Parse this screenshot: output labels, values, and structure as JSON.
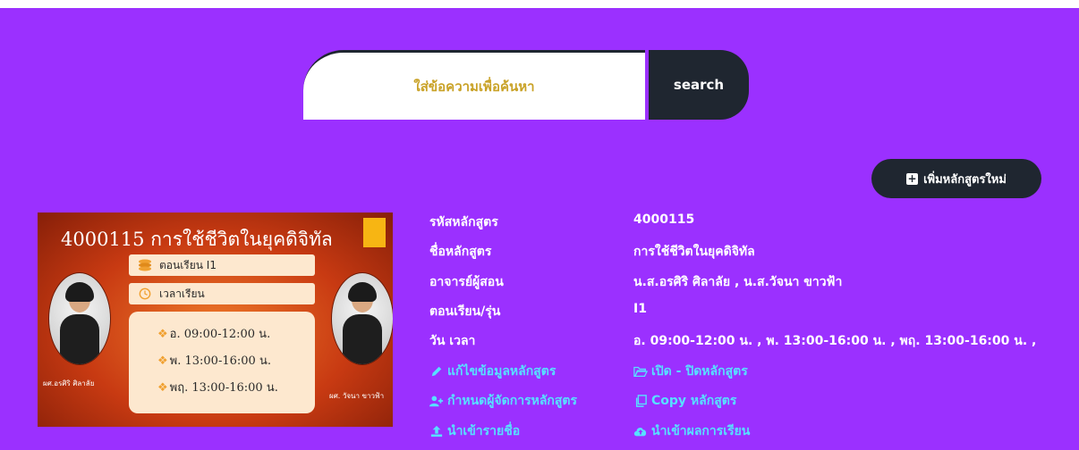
{
  "search": {
    "placeholder": "ใส่ข้อความเพื่อค้นหา",
    "button_label": "search"
  },
  "add_course_label": "เพิ่มหลักสูตรใหม่",
  "banner": {
    "title": "4000115  การใช้ชีวิตในยุคดิจิทัล",
    "section_label": "ตอนเรียน I1",
    "time_label": "เวลาเรียน",
    "schedule": [
      "อ.  09:00-12:00 น.",
      "พ.  13:00-16:00 น.",
      "พฤ. 13:00-16:00 น."
    ],
    "left_name": "ผศ.อรศิริ  ศิลาลัย",
    "right_name": "ผศ. วัจนา  ขาวฟ้า"
  },
  "course": {
    "code_label": "รหัสหลักสูตร",
    "code_value": "4000115",
    "name_label": "ชื่อหลักสูตร",
    "name_value": "การใช้ชีวิตในยุคดิจิทัล",
    "teacher_label": "อาจารย์ผู้สอน",
    "teacher_value": "น.ส.อรศิริ ศิลาลัย , น.ส.วัจนา ขาวฟ้า",
    "section_label": "ตอนเรียน/รุ่น",
    "section_value": "I1",
    "time_label": "วัน เวลา",
    "time_value": "อ. 09:00-12:00 น. , พ. 13:00-16:00 น. , พฤ. 13:00-16:00 น. ,"
  },
  "actions": {
    "edit": "แก้ไขข้อมูลหลักสูตร",
    "toggle": "เปิด - ปิดหลักสูตร",
    "assign_manager": "กำหนดผู้จัดการหลักสูตร",
    "copy": "Copy หลักสูตร",
    "import_names": "นำเข้ารายชื่อ",
    "import_results": "นำเข้าผลการเรียน"
  },
  "colors": {
    "background": "#9b30ff",
    "dark": "#1f2630",
    "link": "#57e0ff",
    "placeholder": "#c9a227"
  }
}
